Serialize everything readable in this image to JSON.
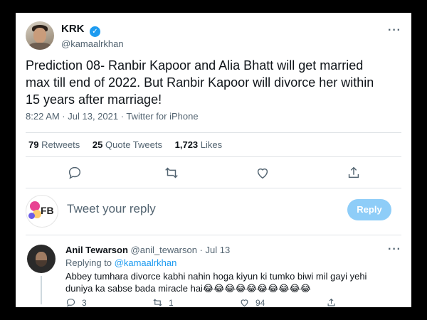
{
  "tweet": {
    "display_name": "KRK",
    "verified_icon": "verified-badge-icon",
    "handle": "@kamaalrkhan",
    "text": "Prediction 08- Ranbir Kapoor and Alia Bhatt will get married max till end of 2022. But Ranbir Kapoor will divorce her within 15 years after marriage!",
    "time": "8:22 AM · Jul 13, 2021 · Twitter for iPhone",
    "retweets_count": "79",
    "retweets_label": "Retweets",
    "quote_count": "25",
    "quote_label": "Quote Tweets",
    "likes_count": "1,723",
    "likes_label": "Likes"
  },
  "composer": {
    "placeholder": "Tweet your reply",
    "reply_button": "Reply",
    "avatar_text": "FB"
  },
  "reply": {
    "name": "Anil Tewarson",
    "handle_date": "@anil_tewarson · Jul 13",
    "replying_prefix": "Replying to",
    "replying_to": "@kamaalrkhan",
    "text": "Abbey tumhara divorce kabhi nahin hoga kiyun ki tumko biwi mil gayi yehi duniya ka sabse bada miracle hai😂😂😂😂😂😂😂😂😂😂",
    "reply_count": "3",
    "retweet_count": "1",
    "like_count": "94"
  },
  "colors": {
    "accent": "#1d9bf0",
    "muted_text": "#536471",
    "reply_button_disabled": "#8ecdf8"
  }
}
